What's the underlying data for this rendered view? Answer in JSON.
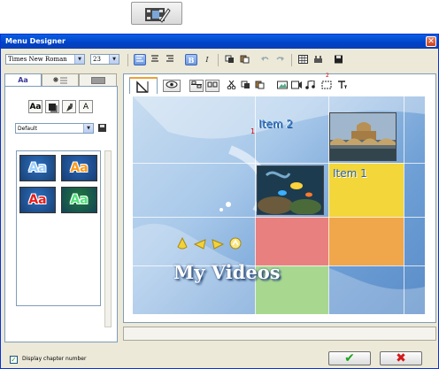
{
  "launcher": {
    "icon": "film-edit-icon"
  },
  "window": {
    "title": "Menu Designer",
    "close_glyph": "✕"
  },
  "toolbar": {
    "font_family": "Times New Roman",
    "font_size": "23",
    "bold_label": "B",
    "italic_label": "I"
  },
  "style_panel": {
    "tabs": [
      {
        "label": "Aa",
        "icon": "text-style-icon"
      },
      {
        "label": "",
        "icon": "magic-wand-list-icon"
      },
      {
        "label": "",
        "icon": "gray-tab-icon"
      }
    ],
    "style_buttons": [
      {
        "label": "Aa",
        "icon": "text-face-icon"
      },
      {
        "label": "",
        "icon": "shadow-icon"
      },
      {
        "label": "",
        "icon": "paint-icon"
      },
      {
        "label": "A",
        "icon": "outline-icon"
      }
    ],
    "preset_value": "Default",
    "swatches": [
      {
        "label": "Aa",
        "bg": "#2d6fc0",
        "fg": "#9ed0ff",
        "stroke": "#ffffff"
      },
      {
        "label": "Aa",
        "bg": "#2a66b8",
        "fg": "#ff9a1a",
        "stroke": "#ffffff"
      },
      {
        "label": "Aa",
        "bg": "#2d6fc0",
        "fg": "#e81d1d",
        "stroke": "#ffffff"
      },
      {
        "label": "Aa",
        "bg": "#1f7a3d",
        "fg": "#4ee37a",
        "stroke": "#ffffff"
      }
    ]
  },
  "canvas": {
    "item1_label": "Item 1",
    "item2_label": "Item 2",
    "item1_number": "1",
    "item2_number": "2",
    "title": "My Videos",
    "colors": {
      "yellow": "#f2d63a",
      "red": "#e98080",
      "orange": "#f0a64a",
      "green": "#a8d890"
    }
  },
  "footer": {
    "display_chapter_number_label": "Display chapter number",
    "display_chapter_number_checked": true,
    "ok_glyph": "✔",
    "cancel_glyph": "✖"
  }
}
